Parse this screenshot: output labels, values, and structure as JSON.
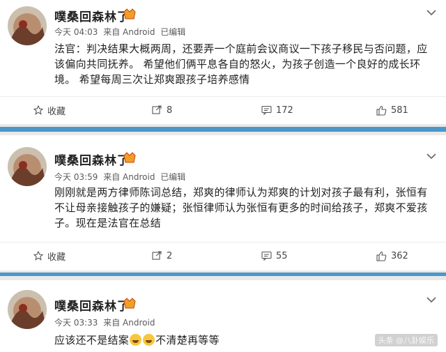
{
  "posts": [
    {
      "username": "噗桑回森林了",
      "time": "今天 04:03",
      "source": "来自 Android",
      "edited": "已编辑",
      "text": "法官：判决结果大概两周，还要弄一个庭前会议商议一下孩子移民与否问题，应该偏向共同抚养。 希望他们俩平息各自的怒火，为孩子创造一个良好的成长环境。 希望每周三次让郑爽跟孩子培养感情",
      "actions": {
        "favorite": "收藏",
        "repost": "8",
        "comment": "172",
        "like": "581"
      }
    },
    {
      "username": "噗桑回森林了",
      "time": "今天 03:59",
      "source": "来自 Android",
      "edited": "已编辑",
      "text": "刚刚就是两方律师陈词总结，郑爽的律师认为郑爽的计划对孩子最有利，张恒有不让母亲接触孩子的嫌疑；张恒律师认为张恒有更多的时间给孩子，郑爽不爱孩子。现在是法官在总结",
      "actions": {
        "favorite": "收藏",
        "repost": "2",
        "comment": "55",
        "like": "362"
      }
    },
    {
      "username": "噗桑回森林了",
      "time": "今天 03:33",
      "source": "来自 Android",
      "text_before": "应该还不是结案",
      "text_after": "不清楚再等等"
    }
  ],
  "watermark": "头条 @八卦娱乐",
  "colors": {
    "separator": "#4b97c9",
    "vip_badge": "#f0a020"
  }
}
